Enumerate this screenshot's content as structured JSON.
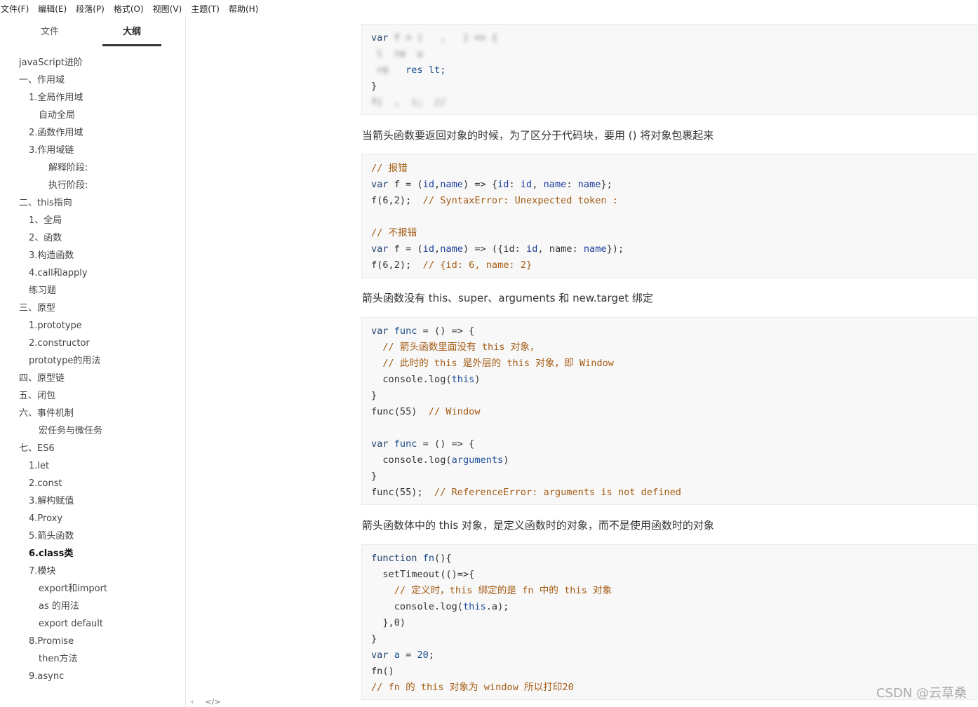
{
  "menu": [
    "文件(F)",
    "编辑(E)",
    "段落(P)",
    "格式(O)",
    "视图(V)",
    "主题(T)",
    "帮助(H)"
  ],
  "sidebar": {
    "tabs": {
      "files": "文件",
      "outline": "大纲"
    },
    "outline": [
      {
        "label": "javaScript进阶",
        "level": 0
      },
      {
        "label": "一、作用域",
        "level": 0
      },
      {
        "label": "1.全局作用域",
        "level": 1
      },
      {
        "label": "自动全局",
        "level": 2
      },
      {
        "label": "2.函数作用域",
        "level": 1
      },
      {
        "label": "3.作用域链",
        "level": 1
      },
      {
        "label": "解释阶段:",
        "level": 3
      },
      {
        "label": "执行阶段:",
        "level": 3
      },
      {
        "label": "二、this指向",
        "level": 0
      },
      {
        "label": "1、全局",
        "level": 1
      },
      {
        "label": "2、函数",
        "level": 1
      },
      {
        "label": "3.构造函数",
        "level": 1
      },
      {
        "label": "4.call和apply",
        "level": 1
      },
      {
        "label": "练习题",
        "level": 1
      },
      {
        "label": "三、原型",
        "level": 0
      },
      {
        "label": "1.prototype",
        "level": 1
      },
      {
        "label": "2.constructor",
        "level": 1
      },
      {
        "label": "prototype的用法",
        "level": 1
      },
      {
        "label": "四、原型链",
        "level": 0
      },
      {
        "label": "五、闭包",
        "level": 0
      },
      {
        "label": "六、事件机制",
        "level": 0
      },
      {
        "label": "宏任务与微任务",
        "level": 2
      },
      {
        "label": "七、ES6",
        "level": 0
      },
      {
        "label": "1.let",
        "level": 1
      },
      {
        "label": "2.const",
        "level": 1
      },
      {
        "label": "3.解构赋值",
        "level": 1
      },
      {
        "label": "4.Proxy",
        "level": 1
      },
      {
        "label": "5.箭头函数",
        "level": 1
      },
      {
        "label": "6.class类",
        "level": 1,
        "active": true
      },
      {
        "label": "7.模块",
        "level": 1
      },
      {
        "label": "export和import",
        "level": 2
      },
      {
        "label": "as 的用法",
        "level": 2
      },
      {
        "label": "export default",
        "level": 2
      },
      {
        "label": "8.Promise",
        "level": 1
      },
      {
        "label": "then方法",
        "level": 2
      },
      {
        "label": "9.async",
        "level": 1
      }
    ],
    "bottom_icons": [
      "chevron-left-icon",
      "code-icon"
    ],
    "bottom_glyphs": [
      "‹",
      "</>"
    ]
  },
  "content": {
    "block0": {
      "l1a": "var",
      "l1b": "f = (   ,   ) => {",
      "l2": " l  re  u ",
      "l3a": " re   ",
      "l3b": "res lt;",
      "l4": "}",
      "l5": "f(  ,  );  //  "
    },
    "para1": "当箭头函数要返回对象的时候，为了区分于代码块，要用 () 将对象包裹起来",
    "block1": {
      "c1": "// 报错",
      "l1": [
        "var",
        " f = (",
        "id",
        ",",
        "name",
        ") => {",
        "id",
        ": ",
        "id",
        ", ",
        "name",
        ": ",
        "name",
        "};"
      ],
      "l2a": "f(6,2);  ",
      "l2c": "// SyntaxError: Unexpected token :",
      "c2": "// 不报错",
      "l3": [
        "var",
        " f = (",
        "id",
        ",",
        "name",
        ") => ({id: ",
        "id",
        ", name: ",
        "name",
        "});"
      ],
      "l4a": "f(6,2);  ",
      "l4c": "// {id: 6, name: 2}"
    },
    "para2": "箭头函数没有 this、super、arguments 和 new.target 绑定",
    "block2": {
      "l1a": "var",
      "l1b": "func",
      "l1c": " = () => {",
      "c1": "  // 箭头函数里面没有 this 对象，",
      "c2": "  // 此时的 this 是外层的 this 对象，即 Window",
      "l2a": "  console.log(",
      "l2b": "this",
      "l2c": ")",
      "l3": "}",
      "l4a": "func(55)  ",
      "l4c": "// Window",
      "l5a": "var",
      "l5b": "func",
      "l5c": " = () => {",
      "l6a": "  console.log(",
      "l6b": "arguments",
      "l6c": ")",
      "l7": "}",
      "l8a": "func(55);  ",
      "l8c": "// ReferenceError: arguments is not defined"
    },
    "para3": "箭头函数体中的 this 对象，是定义函数时的对象，而不是使用函数时的对象",
    "block3": {
      "l1a": "function",
      "l1b": " fn",
      "l1c": "(){",
      "l2": "  setTimeout(()=>{",
      "c1": "    // 定义时，this 绑定的是 fn 中的 this 对象",
      "l3a": "    console.log(",
      "l3b": "this",
      "l3c": ".a);",
      "l4": "  },0)",
      "l5": "}",
      "l6a": "var",
      "l6b": " a",
      "l6c": " = ",
      "l6d": "20",
      "l6e": ";",
      "l7": "fn()",
      "c2": "// fn 的 this 对象为 window 所以打印20"
    }
  },
  "watermark": "CSDN @云草桑"
}
